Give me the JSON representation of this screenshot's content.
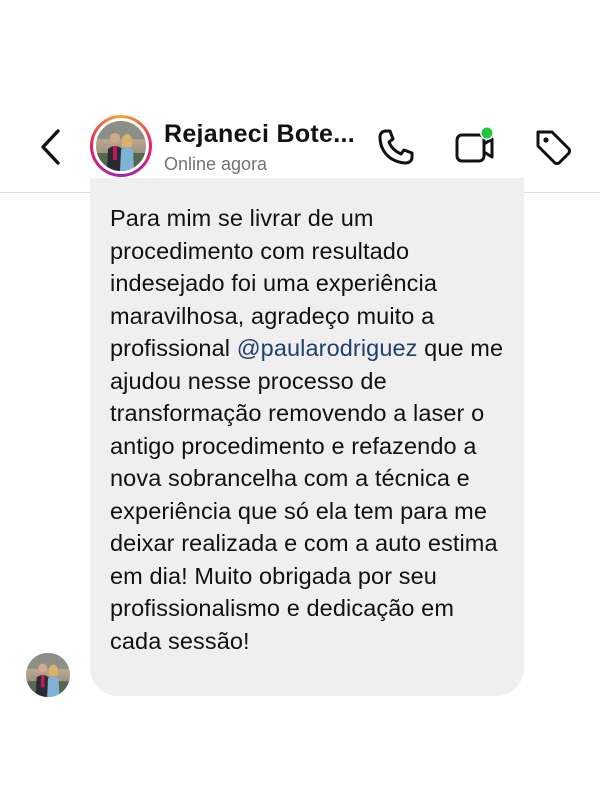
{
  "header": {
    "contact_name": "Rejaneci Bote...",
    "status": "Online agora",
    "online_dot_color": "#24c73b"
  },
  "icons": {
    "back": "chevron-left-icon",
    "call": "phone-icon",
    "video": "video-camera-icon",
    "tag": "tag-icon"
  },
  "message": {
    "text_before": "Para mim se livrar de um procedimento com resultado indesejado foi uma experiência maravilhosa, agradeço muito a profissional ",
    "mention": "@paularodriguez",
    "text_after": " que me ajudou nesse processo de transformação removendo a laser o antigo procedimento e refazendo a nova sobrancelha com a técnica e experiência que só ela tem para me deixar realizada e com a auto estima em dia! Muito obrigada por seu profissionalismo e dedicação em cada sessão!"
  },
  "colors": {
    "bubble_bg": "#efefef",
    "mention": "#1f3f6e",
    "story_ring": [
      "#f9a825",
      "#e91e63",
      "#9c27b0"
    ]
  }
}
